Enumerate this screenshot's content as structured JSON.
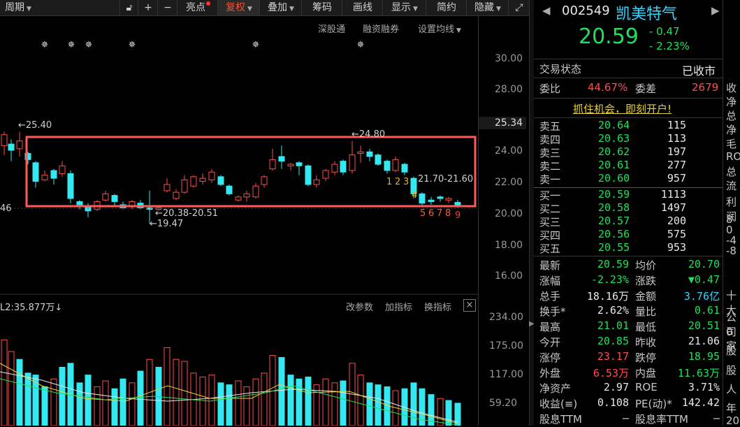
{
  "toolbar": {
    "period": "周期",
    "lock_icon": "lock",
    "plus": "+",
    "minus": "−",
    "highlights": "亮点",
    "adjust": "复权",
    "overlay": "叠加",
    "chips": "筹码",
    "draw": "画线",
    "display": "显示",
    "simple": "简约",
    "hide": "隐藏",
    "expand_icon": "expand"
  },
  "subbar": {
    "deep_pass": "深股通",
    "margin": "融资融券",
    "ma": "设置均线"
  },
  "price_axis": [
    "30.00",
    "28.00",
    "25.34",
    "24.00",
    "22.00",
    "20.00",
    "18.00",
    "16.00"
  ],
  "annotations": {
    "high_label": "←25.40",
    "high2_label": "←24.80",
    "low_label": "←19.47",
    "range_label": "20.38-20.51",
    "range2_label": "21.70-21.60",
    "left_cut": "46",
    "seq_yellow": [
      "1",
      "2",
      "3",
      "4"
    ],
    "seq_red": [
      "5",
      "6",
      "7",
      "8",
      "9"
    ]
  },
  "volume_bar": {
    "label": "L2:35.877万",
    "arrow": "↓",
    "change_param": "改参数",
    "add_ind": "加指标",
    "swap_ind": "换指标",
    "close": "×"
  },
  "volume_axis": [
    "234.00",
    "175.00",
    "117.00",
    "59.20"
  ],
  "stock": {
    "code": "002549",
    "name": "凯美特气",
    "price": "20.59",
    "change": "- 0.47",
    "change_pct": "- 2.23%"
  },
  "status": {
    "label": "交易状态",
    "value": "已收市"
  },
  "ratio": {
    "wb_label": "委比",
    "wb": "44.67%",
    "wc_label": "委差",
    "wc": "2679"
  },
  "promo": "抓住机会，即刻开户!",
  "asks": [
    {
      "l": "卖五",
      "p": "20.64",
      "v": "115"
    },
    {
      "l": "卖四",
      "p": "20.63",
      "v": "113"
    },
    {
      "l": "卖三",
      "p": "20.62",
      "v": "197"
    },
    {
      "l": "卖二",
      "p": "20.61",
      "v": "277"
    },
    {
      "l": "卖一",
      "p": "20.60",
      "v": "957"
    }
  ],
  "bids": [
    {
      "l": "买一",
      "p": "20.59",
      "v": "1113"
    },
    {
      "l": "买二",
      "p": "20.58",
      "v": "1497"
    },
    {
      "l": "买三",
      "p": "20.57",
      "v": "200"
    },
    {
      "l": "买四",
      "p": "20.56",
      "v": "575"
    },
    {
      "l": "买五",
      "p": "20.55",
      "v": "953"
    }
  ],
  "stats": [
    {
      "l1": "最新",
      "v1": "20.59",
      "c1": "green",
      "l2": "均价",
      "v2": "20.70",
      "c2": "green"
    },
    {
      "l1": "涨幅",
      "v1": "-2.23%",
      "c1": "green",
      "l2": "涨跌",
      "v2": "▼0.47",
      "c2": "green"
    },
    {
      "l1": "总手",
      "v1": "18.16万",
      "c1": "white",
      "l2": "金额",
      "v2": "3.76亿",
      "c2": "cyan"
    },
    {
      "l1": "换手*",
      "v1": "2.62%",
      "c1": "white",
      "l2": "量比",
      "v2": "0.61",
      "c2": "green"
    },
    {
      "l1": "最高",
      "v1": "21.01",
      "c1": "green",
      "l2": "最低",
      "v2": "20.51",
      "c2": "green"
    },
    {
      "l1": "今开",
      "v1": "20.85",
      "c1": "green",
      "l2": "昨收",
      "v2": "21.06",
      "c2": "white"
    },
    {
      "l1": "涨停",
      "v1": "23.17",
      "c1": "red",
      "l2": "跌停",
      "v2": "18.95",
      "c2": "green"
    },
    {
      "l1": "外盘",
      "v1": "6.53万",
      "c1": "red",
      "l2": "内盘",
      "v2": "11.63万",
      "c2": "green"
    },
    {
      "l1": "净资产",
      "v1": "2.97",
      "c1": "white",
      "l2": "ROE",
      "v2": "3.71%",
      "c2": "white"
    },
    {
      "l1": "收益(≡)",
      "v1": "0.108",
      "c1": "white",
      "l2": "PE(动)*",
      "v2": "142.42",
      "c2": "white"
    },
    {
      "l1": "股息TTM",
      "v1": "—",
      "c1": "white",
      "l2": "股息率TTM",
      "v2": "—",
      "c2": "white"
    }
  ],
  "edge": [
    "收",
    "净",
    "总",
    "净",
    "毛",
    "RO",
    "总",
    "流",
    "利润",
    "8",
    "0",
    "-4",
    "-8",
    "十大",
    "公司",
    "0家",
    "股",
    "股",
    "人",
    "年",
    "20"
  ],
  "colors": {
    "up": "#ff4d4d",
    "down": "#33e8f0",
    "box": "#ff5a5a"
  }
}
